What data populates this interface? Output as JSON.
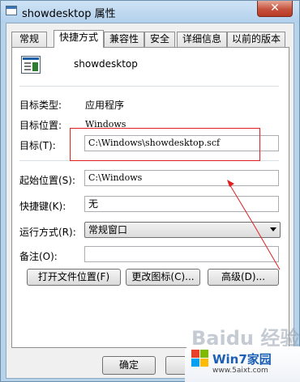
{
  "window": {
    "title": "showdesktop 属性",
    "close_glyph": "✕"
  },
  "tabs": [
    {
      "label": "常规"
    },
    {
      "label": "快捷方式"
    },
    {
      "label": "兼容性"
    },
    {
      "label": "安全"
    },
    {
      "label": "详细信息"
    },
    {
      "label": "以前的版本"
    }
  ],
  "shortcut": {
    "name": "showdesktop",
    "target_type_label": "目标类型:",
    "target_type_value": "应用程序",
    "target_location_label": "目标位置:",
    "target_location_value": "Windows",
    "target_label": "目标(T):",
    "target_value": "C:\\Windows\\showdesktop.scf",
    "start_in_label": "起始位置(S):",
    "start_in_value": "C:\\Windows",
    "hotkey_label": "快捷键(K):",
    "hotkey_value": "无",
    "run_label": "运行方式(R):",
    "run_value": "常规窗口",
    "comment_label": "备注(O):",
    "comment_value": "",
    "open_location_button": "打开文件位置(F)",
    "change_icon_button": "更改图标(C)...",
    "advanced_button": "高级(D)..."
  },
  "footer": {
    "ok_button": "确定"
  },
  "watermark": {
    "baidu": "Baidu 经验",
    "site_name": "Win7家园",
    "site_url": "www.5aixt.com"
  },
  "colors": {
    "annotation_red": "#e02020",
    "title_bg": "#b6d3ea",
    "close_red": "#c6523e"
  },
  "icons": {
    "app_icon": "shortcut-window-icon",
    "title_icon": "window-icon"
  }
}
